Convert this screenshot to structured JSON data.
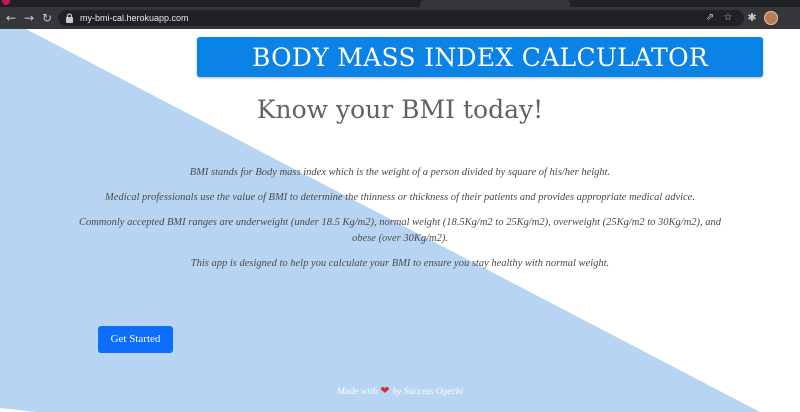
{
  "browser": {
    "url": "my-bmi-cal.herokuapp.com",
    "nav": {
      "back_icon": "back-arrow-icon",
      "forward_icon": "forward-arrow-icon",
      "reload_icon": "reload-icon"
    },
    "icons": [
      "lock-icon",
      "share-icon",
      "star-icon",
      "puzzle-icon",
      "profile-avatar"
    ]
  },
  "page": {
    "title": "BODY MASS INDEX CALCULATOR",
    "heading": "Know your BMI today!",
    "paragraphs": [
      "BMI stands for Body mass index which is the weight of a person divided by square of his/her height.",
      "Medical professionals use the value of BMI to determine the thinness or thickness of their patients and provides appropriate medical advice.",
      "Commonly accepted BMI ranges are underweight (under 18.5 Kg/m2), normal weight (18.5Kg/m2 to 25Kg/m2), overweight (25Kg/m2 to 30Kg/m2), and obese (over 30Kg/m2).",
      "This app is designed to help you calculate your BMI to ensure you stay healthy with normal weight."
    ],
    "cta_label": "Get Started",
    "footer": {
      "prefix": "Made with",
      "suffix": "by Success Ogechi"
    }
  },
  "colors": {
    "banner": "#0b82e6",
    "background_shape": "#b7d5f2",
    "button": "#0d6efd",
    "heart": "#d32f2f"
  }
}
